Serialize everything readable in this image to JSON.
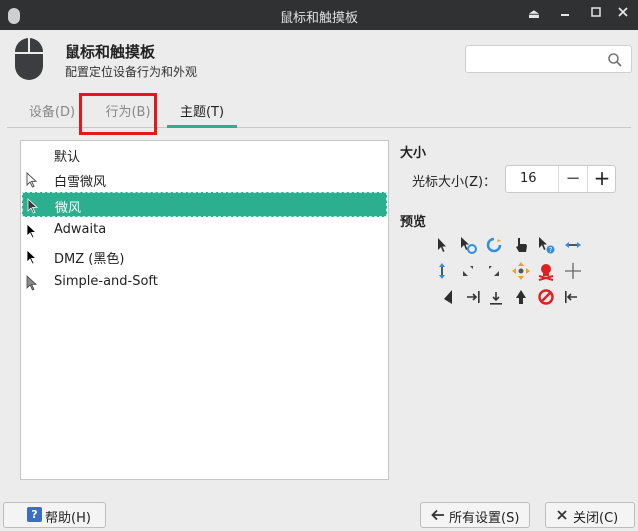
{
  "window": {
    "title": "鼠标和触摸板"
  },
  "header": {
    "title": "鼠标和触摸板",
    "subtitle": "配置定位设备行为和外观",
    "search_placeholder": ""
  },
  "tabs": [
    {
      "label": "设备(D)",
      "active": false
    },
    {
      "label": "行为(B)",
      "active": false
    },
    {
      "label": "主题(T)",
      "active": true
    }
  ],
  "themes": [
    {
      "label": "默认",
      "cursor": "none",
      "selected": false
    },
    {
      "label": "白雪微风",
      "cursor": "white-arrow",
      "selected": false
    },
    {
      "label": "微风",
      "cursor": "dark-arrow",
      "selected": true
    },
    {
      "label": "Adwaita",
      "cursor": "black-arrow",
      "selected": false
    },
    {
      "label": "DMZ (黑色)",
      "cursor": "black-arrow",
      "selected": false
    },
    {
      "label": "Simple-and-Soft",
      "cursor": "gray-arrow",
      "selected": false
    }
  ],
  "size": {
    "title": "大小",
    "label": "光标大小(Z)：",
    "value": "16",
    "minus": "−",
    "plus": "+"
  },
  "preview": {
    "title": "预览"
  },
  "buttons": {
    "help": "帮助(H)",
    "all_settings": "所有设置(S)",
    "close": "关闭(C)"
  },
  "colors": {
    "accent": "#2baf8f",
    "titlebar": "#2f3133",
    "highlight": "#e5171b"
  }
}
